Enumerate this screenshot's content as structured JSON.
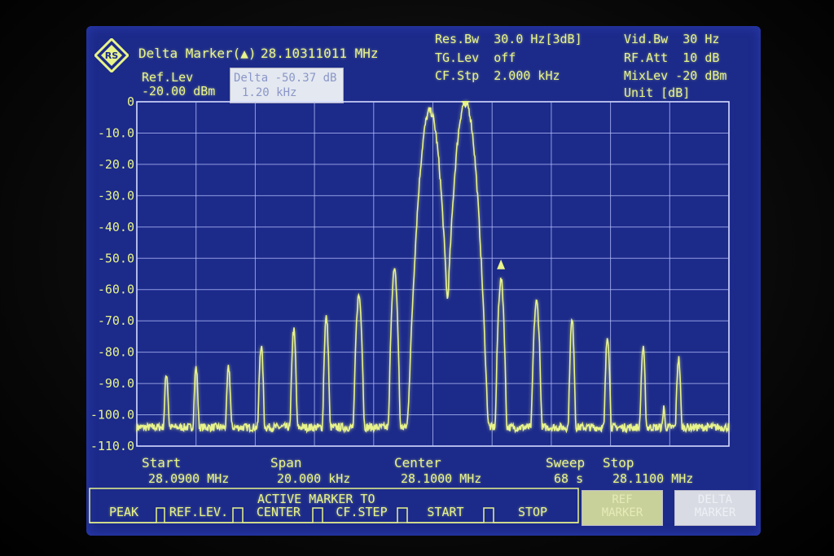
{
  "header": {
    "marker_title": "Delta Marker(▲)",
    "marker_freq": "28.10311011 MHz",
    "ref_lev_label": "Ref.Lev",
    "ref_lev_value": "-20.00 dBm",
    "delta_line1": "Delta -50.37 dB",
    "delta_line2": "1.20 kHz",
    "res_bw": "Res.Bw  30.0 Hz[3dB]",
    "tg_lev": "TG.Lev  off",
    "cf_stp": "CF.Stp  2.000 kHz",
    "vid_bw": "Vid.Bw  30 Hz",
    "rf_att": "RF.Att  10 dB",
    "mix_lev": "MixLev -20 dBm",
    "unit": "Unit [dB]"
  },
  "footer": {
    "start_label": "Start",
    "start_value": "28.0900 MHz",
    "span_label": "Span",
    "span_value": "20.000 kHz",
    "center_label": "Center",
    "center_value": "28.1000 MHz",
    "sweep_label": "Sweep",
    "sweep_value": "68 s",
    "stop_label": "Stop",
    "stop_value": "28.1100 MHz"
  },
  "softkeys": {
    "group_title": "ACTIVE MARKER TO",
    "peak": "PEAK",
    "ref_lev": "REF.LEV.",
    "center": "CENTER",
    "cf_step": "CF.STEP",
    "start": "START",
    "stop": "STOP",
    "ref_marker": "REF\nMARKER",
    "delta_marker": "DELTA\nMARKER"
  },
  "colors": {
    "screen": "#1c2a8a",
    "trace": "#e8f48a",
    "grid": "#c8d2ff",
    "ref_marker_key": "#c9d19a",
    "delta_marker_key": "#d9dbe4"
  },
  "chart_data": {
    "type": "line",
    "ylabel": "dB",
    "ylim": [
      -110,
      0
    ],
    "xlim": [
      28.09,
      28.11
    ],
    "x_unit": "MHz",
    "y_ticks": [
      "0",
      "-10.0",
      "-20.0",
      "-30.0",
      "-40.0",
      "-50.0",
      "-60.0",
      "-70.0",
      "-80.0",
      "-90.0",
      "-100.0",
      "-110.0"
    ],
    "grid": true,
    "noise_floor": -104,
    "peaks": [
      {
        "x": 28.091,
        "y": -87,
        "w": 3e-05
      },
      {
        "x": 28.092,
        "y": -85,
        "w": 3e-05
      },
      {
        "x": 28.0931,
        "y": -85,
        "w": 3e-05
      },
      {
        "x": 28.0942,
        "y": -78,
        "w": 3e-05
      },
      {
        "x": 28.0953,
        "y": -73,
        "w": 3e-05
      },
      {
        "x": 28.0964,
        "y": -69,
        "w": 3e-05
      },
      {
        "x": 28.0975,
        "y": -62,
        "w": 4e-05
      },
      {
        "x": 28.0987,
        "y": -54,
        "w": 4e-05
      },
      {
        "x": 28.0999,
        "y": -3,
        "w": 0.00011
      },
      {
        "x": 28.1011,
        "y": 0,
        "w": 0.00011
      },
      {
        "x": 28.1023,
        "y": -57,
        "w": 4e-05
      },
      {
        "x": 28.1035,
        "y": -64,
        "w": 4e-05
      },
      {
        "x": 28.1047,
        "y": -70,
        "w": 3e-05
      },
      {
        "x": 28.1059,
        "y": -75,
        "w": 3e-05
      },
      {
        "x": 28.1071,
        "y": -79,
        "w": 3e-05
      },
      {
        "x": 28.1078,
        "y": -98,
        "w": 2e-05
      },
      {
        "x": 28.1083,
        "y": -82,
        "w": 3e-05
      }
    ],
    "ref_marker": {
      "x": 28.1011,
      "y": 0
    },
    "delta_marker": {
      "x": 28.1023,
      "y": -50.37
    }
  }
}
